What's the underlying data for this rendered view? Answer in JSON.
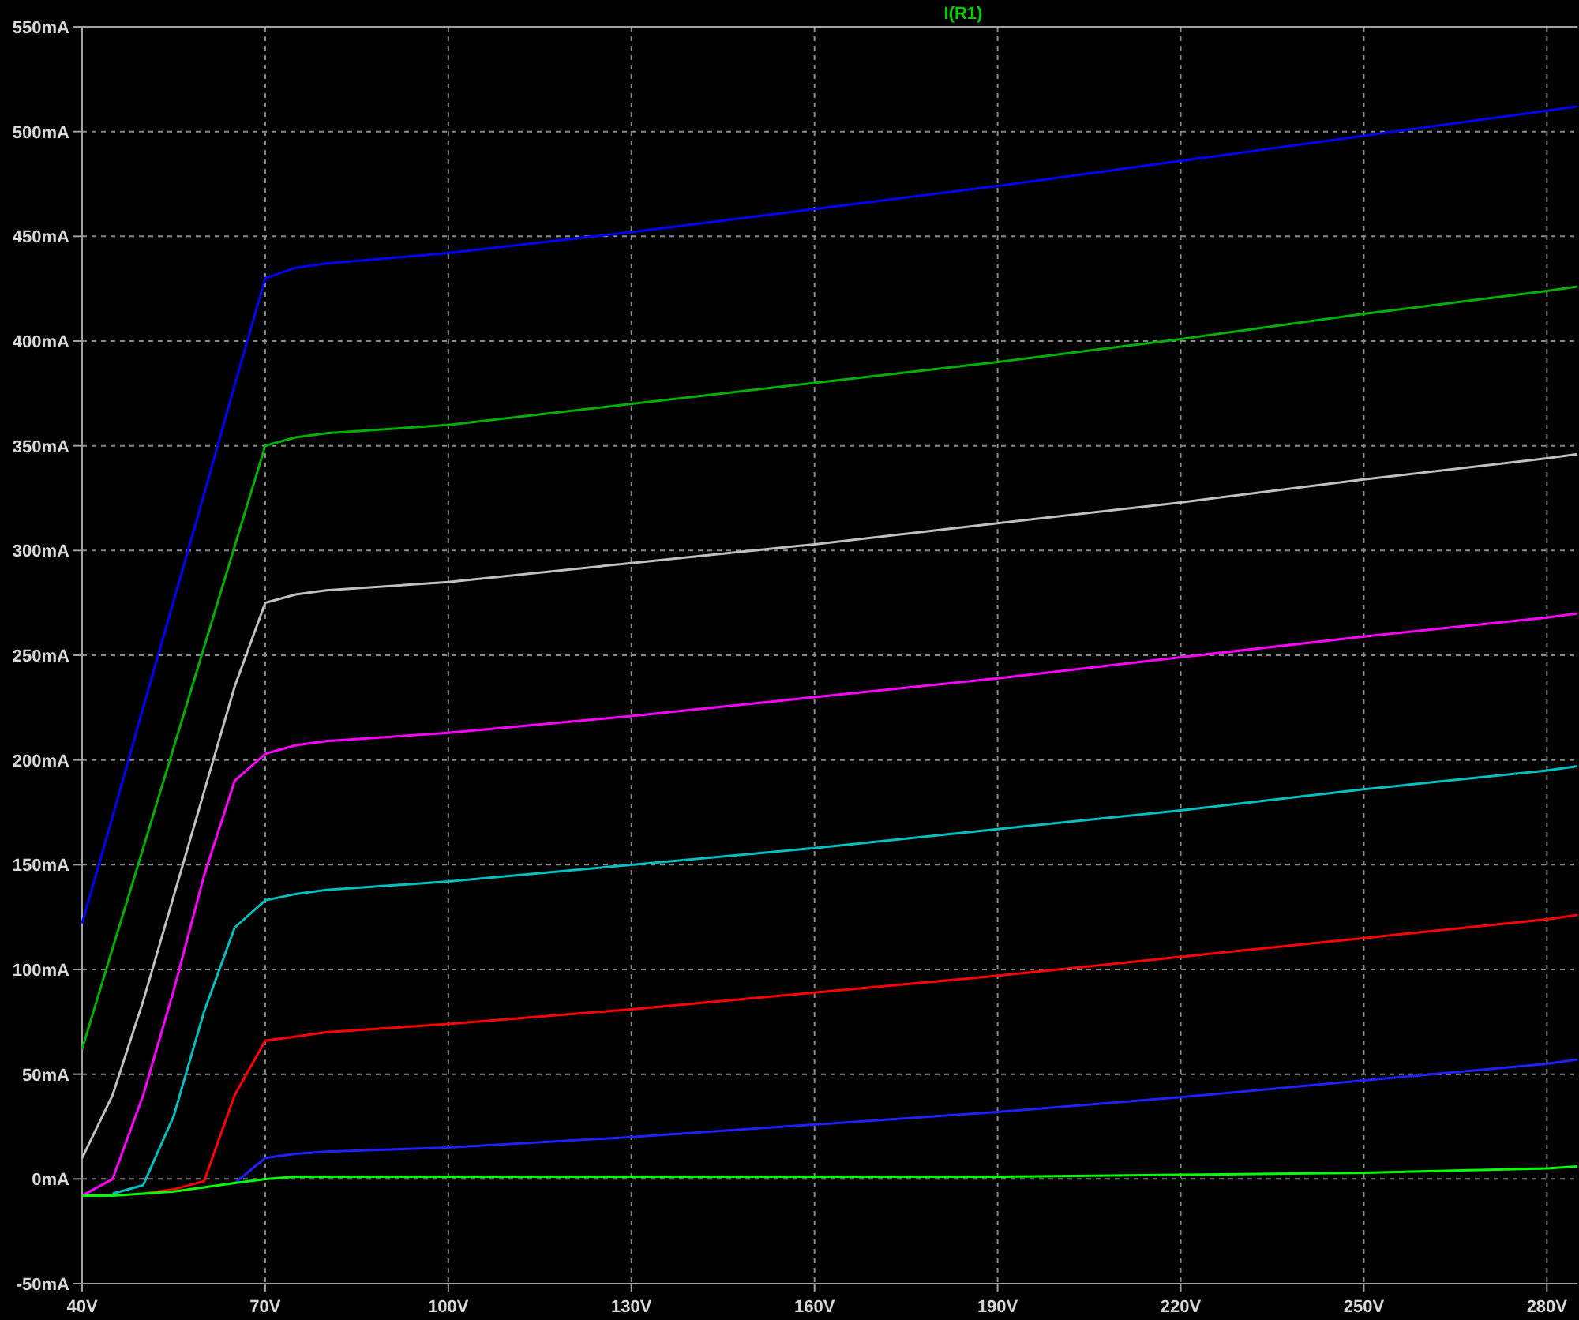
{
  "plot": {
    "chart_data": {
      "type": "line",
      "title": "I(R1)",
      "x": [
        40,
        45,
        50,
        55,
        60,
        65,
        70,
        75,
        80,
        100,
        130,
        160,
        190,
        220,
        250,
        280,
        285
      ],
      "series": [
        {
          "color": "#0000ff",
          "values": [
            122,
            173,
            225,
            276,
            327,
            379,
            430,
            435,
            437,
            442,
            452,
            463,
            474,
            486,
            498,
            510,
            512
          ]
        },
        {
          "color": "#00b000",
          "values": [
            62,
            110,
            158,
            206,
            254,
            302,
            350,
            354,
            356,
            360,
            370,
            380,
            390,
            401,
            413,
            424,
            426
          ]
        },
        {
          "color": "#c0c0c0",
          "values": [
            10,
            40,
            85,
            135,
            185,
            235,
            275,
            279,
            281,
            285,
            294,
            303,
            313,
            323,
            334,
            344,
            346
          ]
        },
        {
          "color": "#ff00ff",
          "values": [
            -8,
            0,
            40,
            90,
            145,
            190,
            203,
            207,
            209,
            213,
            221,
            230,
            239,
            249,
            259,
            268,
            270
          ]
        },
        {
          "color": "#00c0c0",
          "values": [
            null,
            -7,
            -3,
            30,
            80,
            120,
            133,
            136,
            138,
            142,
            150,
            158,
            167,
            176,
            186,
            195,
            197
          ]
        },
        {
          "color": "#ff0000",
          "values": [
            null,
            null,
            -7,
            -5,
            -1,
            40,
            66,
            68,
            70,
            74,
            81,
            89,
            97,
            106,
            115,
            124,
            126
          ]
        },
        {
          "color": "#2020ff",
          "values": [
            null,
            null,
            null,
            null,
            null,
            -2,
            10,
            12,
            13,
            15,
            20,
            26,
            32,
            39,
            47,
            55,
            57
          ]
        },
        {
          "color": "#00ff00",
          "values": [
            -8,
            -8,
            -7,
            -6,
            -4,
            -2,
            0,
            1,
            1,
            1,
            1,
            1,
            1,
            2,
            3,
            5,
            6
          ]
        }
      ],
      "grid": true,
      "xlim": [
        40,
        285
      ],
      "ylim": [
        -50,
        550
      ],
      "xticks": [
        {
          "value": 40,
          "label": "40V"
        },
        {
          "value": 70,
          "label": "70V"
        },
        {
          "value": 100,
          "label": "100V"
        },
        {
          "value": 130,
          "label": "130V"
        },
        {
          "value": 160,
          "label": "160V"
        },
        {
          "value": 190,
          "label": "190V"
        },
        {
          "value": 220,
          "label": "220V"
        },
        {
          "value": 250,
          "label": "250V"
        },
        {
          "value": 280,
          "label": "280V"
        }
      ],
      "yticks": [
        {
          "value": -50,
          "label": "-50mA"
        },
        {
          "value": 0,
          "label": "0mA"
        },
        {
          "value": 50,
          "label": "50mA"
        },
        {
          "value": 100,
          "label": "100mA"
        },
        {
          "value": 150,
          "label": "150mA"
        },
        {
          "value": 200,
          "label": "200mA"
        },
        {
          "value": 250,
          "label": "250mA"
        },
        {
          "value": 300,
          "label": "300mA"
        },
        {
          "value": 350,
          "label": "350mA"
        },
        {
          "value": 400,
          "label": "400mA"
        },
        {
          "value": 450,
          "label": "450mA"
        },
        {
          "value": 500,
          "label": "500mA"
        },
        {
          "value": 550,
          "label": "550mA"
        }
      ]
    }
  }
}
